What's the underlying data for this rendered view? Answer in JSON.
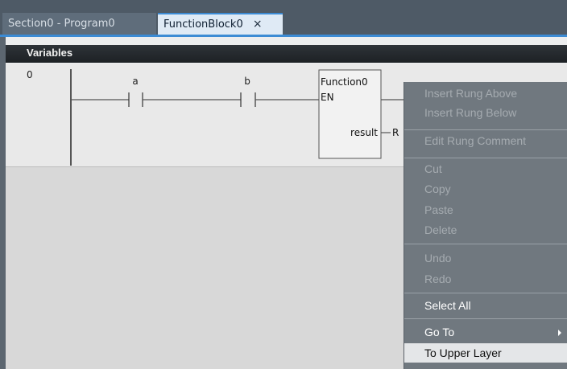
{
  "tabs": [
    {
      "label": "Section0 - Program0",
      "active": false
    },
    {
      "label": "FunctionBlock0",
      "active": true,
      "close_glyph": "×"
    }
  ],
  "variables_header": "Variables",
  "ladder": {
    "rung_number": "0",
    "contacts": [
      {
        "label": "a"
      },
      {
        "label": "b"
      }
    ],
    "function_block": {
      "instance": "Function0",
      "input": "EN",
      "output": "result",
      "output_var": "R"
    }
  },
  "context_menu": {
    "items": [
      {
        "label": "Insert Rung Above",
        "state": "disabled"
      },
      {
        "label": "Insert Rung Below",
        "state": "disabled"
      },
      {
        "label": "Edit Rung Comment",
        "state": "disabled"
      },
      {
        "label": "Cut",
        "state": "disabled"
      },
      {
        "label": "Copy",
        "state": "disabled"
      },
      {
        "label": "Paste",
        "state": "disabled"
      },
      {
        "label": "Delete",
        "state": "disabled"
      },
      {
        "label": "Undo",
        "state": "disabled"
      },
      {
        "label": "Redo",
        "state": "disabled"
      },
      {
        "label": "Select All",
        "state": "enabled"
      },
      {
        "label": "Go To",
        "state": "enabled",
        "has_submenu": true
      },
      {
        "label": "To Upper Layer",
        "state": "highlighted"
      }
    ]
  },
  "colors": {
    "tab_accent": "#3c8bd4",
    "menu_background": "#70787f",
    "menu_highlight": "#e4e6e8",
    "editor_background": "#d8d8d8"
  }
}
